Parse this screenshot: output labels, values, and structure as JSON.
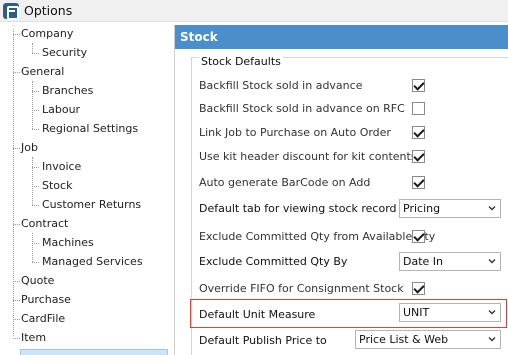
{
  "window": {
    "title": "Options",
    "app_icon": "app-logo-icon"
  },
  "tree": {
    "items": [
      {
        "id": "company",
        "label": "Company"
      },
      {
        "id": "security",
        "label": "Security"
      },
      {
        "id": "general",
        "label": "General"
      },
      {
        "id": "branches",
        "label": "Branches"
      },
      {
        "id": "labour",
        "label": "Labour"
      },
      {
        "id": "regional",
        "label": "Regional Settings"
      },
      {
        "id": "job",
        "label": "Job"
      },
      {
        "id": "invoice",
        "label": "Invoice"
      },
      {
        "id": "stock",
        "label": "Stock"
      },
      {
        "id": "customer_returns",
        "label": "Customer Returns"
      },
      {
        "id": "contract",
        "label": "Contract"
      },
      {
        "id": "machines",
        "label": "Machines"
      },
      {
        "id": "managed_services",
        "label": "Managed Services"
      },
      {
        "id": "quote",
        "label": "Quote"
      },
      {
        "id": "purchase",
        "label": "Purchase"
      },
      {
        "id": "cardfile",
        "label": "CardFile"
      },
      {
        "id": "item",
        "label": "Item"
      }
    ]
  },
  "panel": {
    "title": "Stock",
    "header_color": "#4a8fcb",
    "group_title": "Stock Defaults",
    "settings": {
      "backfill": {
        "label": "Backfill Stock sold in advance",
        "checked": true
      },
      "backfill_rfc": {
        "label": "Backfill Stock sold in advance on RFC",
        "checked": false
      },
      "link_job": {
        "label": "Link Job to Purchase on Auto Order",
        "checked": true
      },
      "kit_header": {
        "label": "Use kit header discount for kit contents",
        "checked": true
      },
      "barcode": {
        "label": "Auto generate BarCode on Add",
        "checked": true
      },
      "default_tab": {
        "label": "Default tab for viewing stock record",
        "value": "Pricing"
      },
      "exclude_committed": {
        "label": "Exclude Committed Qty from Available Qty",
        "checked": true
      },
      "exclude_by": {
        "label": "Exclude Committed Qty By",
        "value": "Date In"
      },
      "fifo": {
        "label": "Override FIFO for Consignment Stock",
        "checked": true
      },
      "unit_measure": {
        "label": "Default Unit Measure",
        "value": "UNIT"
      },
      "publish_price": {
        "label": "Default Publish Price to",
        "value": "Price List & Web"
      }
    },
    "highlight_color": "#d9443a"
  }
}
